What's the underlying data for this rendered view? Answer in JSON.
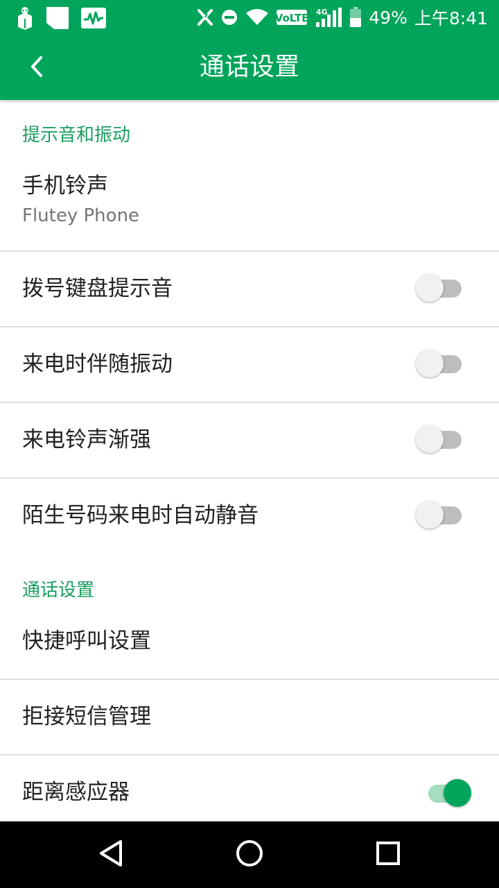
{
  "status_bar": {
    "left_icons": [
      "notification-bag-icon",
      "blank-notification-icon",
      "activity-monitor-icon"
    ],
    "right_icons": [
      "x-network-icon",
      "do-not-disturb-icon",
      "wifi-icon",
      "volte-icon",
      "signal-4g-icon",
      "battery-icon"
    ],
    "volte_label": "VoLTE",
    "network_label": "4G",
    "battery": "49%",
    "time": "上午8:41"
  },
  "app_bar": {
    "title": "通话设置",
    "back_icon": "back-arrow-icon",
    "color": "#00a45a"
  },
  "sections": [
    {
      "header": "提示音和振动",
      "items": [
        {
          "title": "手机铃声",
          "subtitle": "Flutey Phone"
        },
        {
          "title": "拨号键盘提示音",
          "toggle": false
        },
        {
          "title": "来电时伴随振动",
          "toggle": false
        },
        {
          "title": "来电铃声渐强",
          "toggle": false
        },
        {
          "title": "陌生号码来电时自动静音",
          "toggle": false
        }
      ]
    },
    {
      "header": "通话设置",
      "items": [
        {
          "title": "快捷呼叫设置"
        },
        {
          "title": "拒接短信管理"
        },
        {
          "title": "距离感应器",
          "toggle": true
        }
      ]
    }
  ],
  "colors": {
    "accent": "#00a45a",
    "section_header": "#1a9e5f",
    "switch_off_track": "#bdbdbd",
    "switch_on_track": "#a6dcc0"
  },
  "nav_bar": {
    "icons": [
      "back-triangle-icon",
      "home-circle-icon",
      "recents-square-icon"
    ]
  }
}
